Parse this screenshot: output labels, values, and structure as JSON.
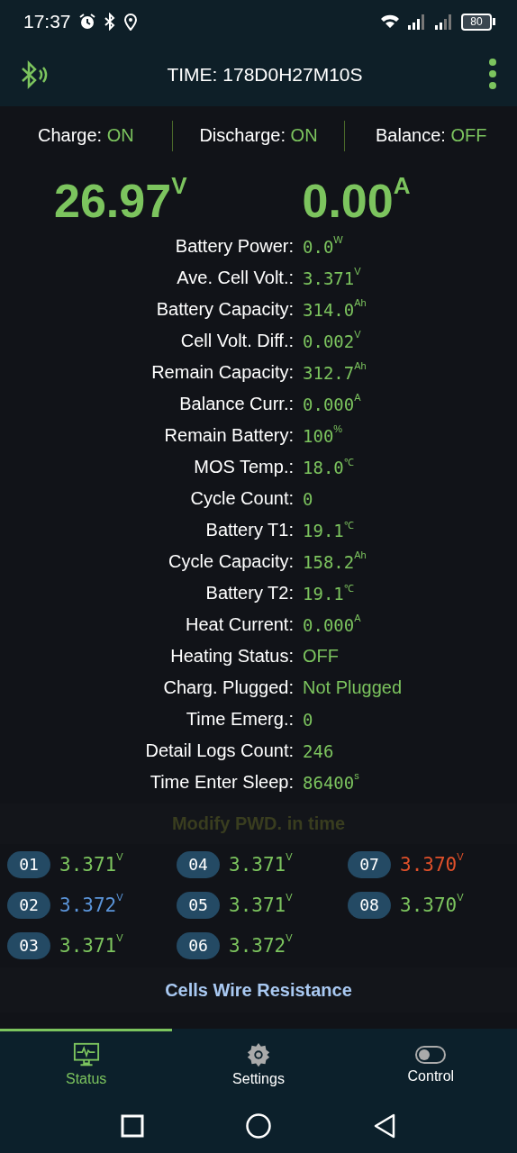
{
  "status_bar": {
    "time": "17:37",
    "battery": "80"
  },
  "app_bar": {
    "title": "TIME: 178D0H27M10S"
  },
  "switches": [
    {
      "label": "Charge:",
      "value": "ON"
    },
    {
      "label": "Discharge:",
      "value": "ON"
    },
    {
      "label": "Balance:",
      "value": "OFF"
    }
  ],
  "voltage": {
    "value": "26.97",
    "unit": "V"
  },
  "current": {
    "value": "0.00",
    "unit": "A"
  },
  "params": [
    {
      "label": "Battery Power:",
      "value": "0.0",
      "unit": "W",
      "kind": "numeric"
    },
    {
      "label": "Ave. Cell Volt.:",
      "value": "3.371",
      "unit": "V",
      "kind": "numeric"
    },
    {
      "label": "Battery Capacity:",
      "value": "314.0",
      "unit": "Ah",
      "kind": "numeric"
    },
    {
      "label": "Cell Volt. Diff.:",
      "value": "0.002",
      "unit": "V",
      "kind": "numeric"
    },
    {
      "label": "Remain Capacity:",
      "value": "312.7",
      "unit": "Ah",
      "kind": "numeric"
    },
    {
      "label": "Balance Curr.:",
      "value": "0.000",
      "unit": "A",
      "kind": "numeric"
    },
    {
      "label": "Remain Battery:",
      "value": "100",
      "unit": "%",
      "kind": "numeric"
    },
    {
      "label": "MOS Temp.:",
      "value": "18.0",
      "unit": "℃",
      "kind": "numeric"
    },
    {
      "label": "Cycle Count:",
      "value": "0",
      "kind": "numeric"
    },
    {
      "label": "Battery T1:",
      "value": "19.1",
      "unit": "℃",
      "kind": "numeric"
    },
    {
      "label": "Cycle Capacity:",
      "value": "158.2",
      "unit": "Ah",
      "kind": "numeric"
    },
    {
      "label": "Battery T2:",
      "value": "19.1",
      "unit": "℃",
      "kind": "numeric"
    },
    {
      "label": "Heat Current:",
      "value": "0.000",
      "unit": "A",
      "kind": "numeric"
    },
    {
      "label": "Heating Status:",
      "value": "OFF",
      "kind": "text"
    },
    {
      "label": "Charg. Plugged:",
      "value": "Not Plugged",
      "kind": "text"
    },
    {
      "label": "Time Emerg.:",
      "value": "0",
      "kind": "numeric"
    },
    {
      "label": "Detail Logs Count:",
      "value": "246",
      "kind": "numeric"
    },
    {
      "label": "Time Enter Sleep:",
      "value": "86400",
      "unit": "s",
      "kind": "numeric"
    }
  ],
  "notice": "Modify PWD. in time",
  "cells": [
    {
      "index": "01",
      "value": "3.371",
      "unit": "V",
      "color": "#7cc45e"
    },
    {
      "index": "02",
      "value": "3.372",
      "unit": "V",
      "color": "#5b95da"
    },
    {
      "index": "03",
      "value": "3.371",
      "unit": "V",
      "color": "#7cc45e"
    },
    {
      "index": "04",
      "value": "3.371",
      "unit": "V",
      "color": "#7cc45e"
    },
    {
      "index": "05",
      "value": "3.371",
      "unit": "V",
      "color": "#7cc45e"
    },
    {
      "index": "06",
      "value": "3.372",
      "unit": "V",
      "color": "#7cc45e"
    },
    {
      "index": "07",
      "value": "3.370",
      "unit": "V",
      "color": "#e0502a"
    },
    {
      "index": "08",
      "value": "3.370",
      "unit": "V",
      "color": "#7cc45e"
    }
  ],
  "resistance": {
    "title": "Cells Wire Resistance"
  },
  "tabs": [
    {
      "label": "Status",
      "selected": true
    },
    {
      "label": "Settings",
      "selected": false
    },
    {
      "label": "Control",
      "selected": false
    }
  ]
}
